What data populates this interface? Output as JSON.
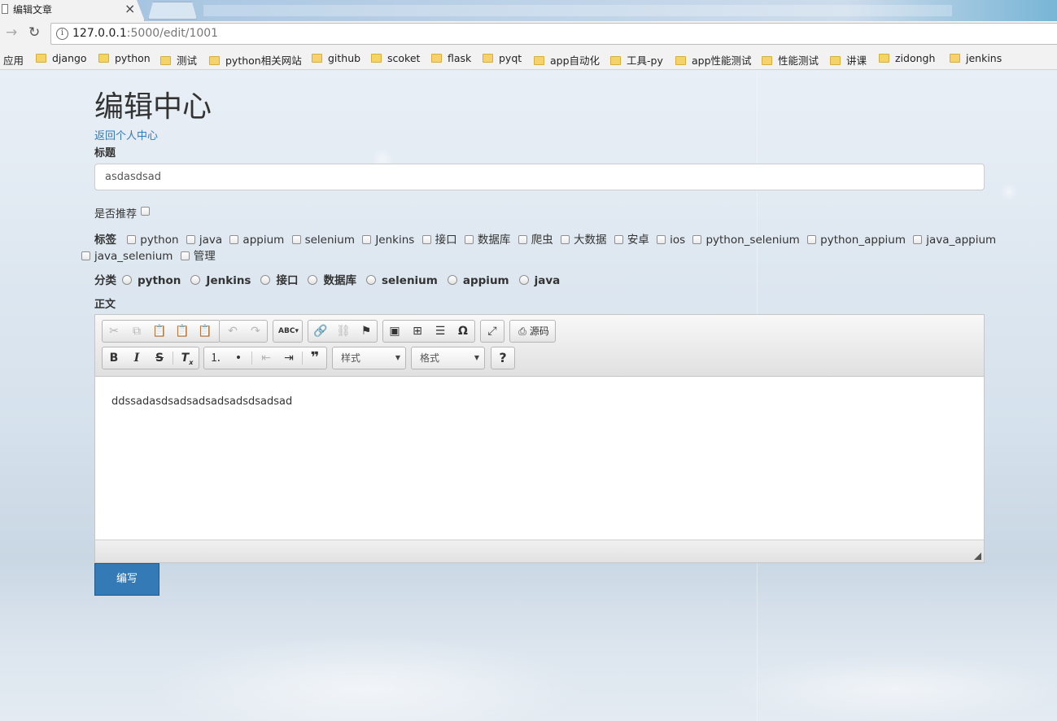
{
  "browser": {
    "tab_title": "编辑文章",
    "url_host": "127.0.0.1",
    "url_rest": ":5000/edit/1001",
    "bookmarks": [
      "应用",
      "django",
      "python",
      "测试",
      "python相关网站",
      "github",
      "scoket",
      "flask",
      "pyqt",
      "app自动化",
      "工具-py",
      "app性能测试",
      "性能测试",
      "讲课",
      "zidongh",
      "jenkins"
    ]
  },
  "page": {
    "title": "编辑中心",
    "back_link": "返回个人中心",
    "title_label": "标题",
    "title_value": "asdasdsad",
    "recommend_label": "是否推荐",
    "tags_label": "标签",
    "tags_row1": [
      "python",
      "java",
      "appium",
      "selenium",
      "Jenkins",
      "接口",
      "数据库",
      "爬虫",
      "大数据",
      "安卓",
      "ios",
      "python_selenium",
      "python_appium",
      "java_appium"
    ],
    "tags_row2": [
      "java_selenium",
      "管理"
    ],
    "category_label": "分类",
    "categories": [
      "python",
      "Jenkins",
      "接口",
      "数据库",
      "selenium",
      "appium",
      "java"
    ],
    "body_label": "正文",
    "editor": {
      "source_label": "源码",
      "style_combo": "样式",
      "format_combo": "格式",
      "help_label": "?",
      "content": "ddssadasdsadsadsadsadsdsadsad"
    },
    "submit_label": "编写"
  }
}
